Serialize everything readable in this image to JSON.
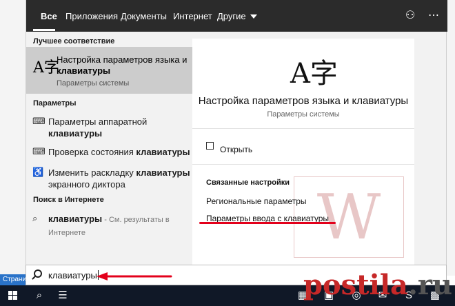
{
  "page_strip": "Страни",
  "tabs": [
    {
      "label": "Все"
    },
    {
      "label": "Приложения"
    },
    {
      "label": "Документы"
    },
    {
      "label": "Интернет"
    },
    {
      "label": "Другие"
    }
  ],
  "toolbar": {
    "feedback_icon": "feedback-icon",
    "more_icon": "more-icon"
  },
  "left": {
    "best_match_header": "Лучшее соответствие",
    "best_match": {
      "icon": "language-icon",
      "title": "Настройка параметров языка и",
      "title_bold": "клавиатуры",
      "subtitle": "Параметры системы"
    },
    "settings_header": "Параметры",
    "settings": [
      {
        "icon": "keyboard-icon",
        "text": "Параметры аппаратной",
        "bold": "клавиатуры"
      },
      {
        "icon": "keyboard-icon",
        "text": "Проверка состояния",
        "bold": "клавиатуры"
      },
      {
        "icon": "accessibility-icon",
        "text": "Изменить раскладку",
        "bold": "клавиатуры",
        "text2": "экранного диктора"
      }
    ],
    "web_header": "Поиск в Интернете",
    "web_item": {
      "bold": "клавиатуры",
      "suffix": " - См. результаты в",
      "suffix2": "Интернете"
    }
  },
  "right": {
    "title": "Настройка параметров языка и клавиатуры",
    "subtitle": "Параметры системы",
    "open_label": "Открыть",
    "related_header": "Связанные настройки",
    "related": [
      "Региональные параметры",
      "Параметры ввода с клавиатуры"
    ]
  },
  "search": {
    "value": "клавиатуры"
  },
  "watermark": "W",
  "brand": {
    "name": "postila",
    "tld": ".ru"
  },
  "colors": {
    "accent_red": "#e3001b",
    "tabbar": "#2b2b2b",
    "taskbar": "#101827"
  }
}
